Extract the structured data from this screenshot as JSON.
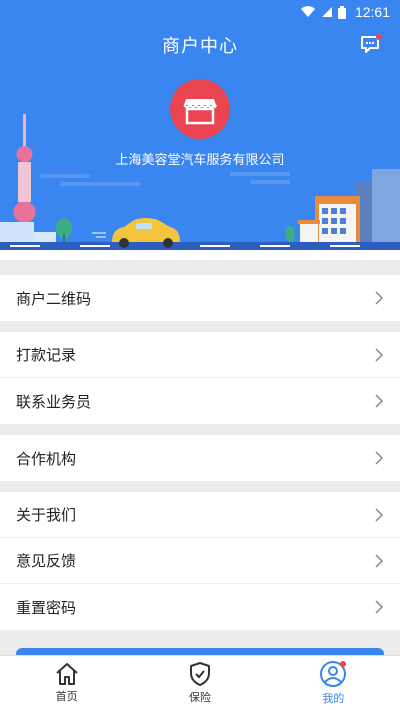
{
  "status_bar": {
    "time": "12:61"
  },
  "header": {
    "title": "商户中心",
    "message_icon": "chat-bubble-icon"
  },
  "merchant": {
    "name": "上海美容堂汽车服务有限公司",
    "logo_icon": "shop-icon",
    "logo_color": "#e94450"
  },
  "menu_groups": [
    [
      {
        "label": "商户二维码"
      }
    ],
    [
      {
        "label": "打款记录"
      },
      {
        "label": "联系业务员"
      }
    ],
    [
      {
        "label": "合作机构"
      }
    ],
    [
      {
        "label": "关于我们"
      },
      {
        "label": "意见反馈"
      },
      {
        "label": "重置密码"
      }
    ]
  ],
  "tabs": [
    {
      "label": "首页",
      "icon": "home-icon"
    },
    {
      "label": "保险",
      "icon": "shield-check-icon"
    },
    {
      "label": "我的",
      "icon": "user-icon",
      "active": true
    }
  ],
  "colors": {
    "brand": "#3a86f0",
    "badge": "#e94450"
  }
}
